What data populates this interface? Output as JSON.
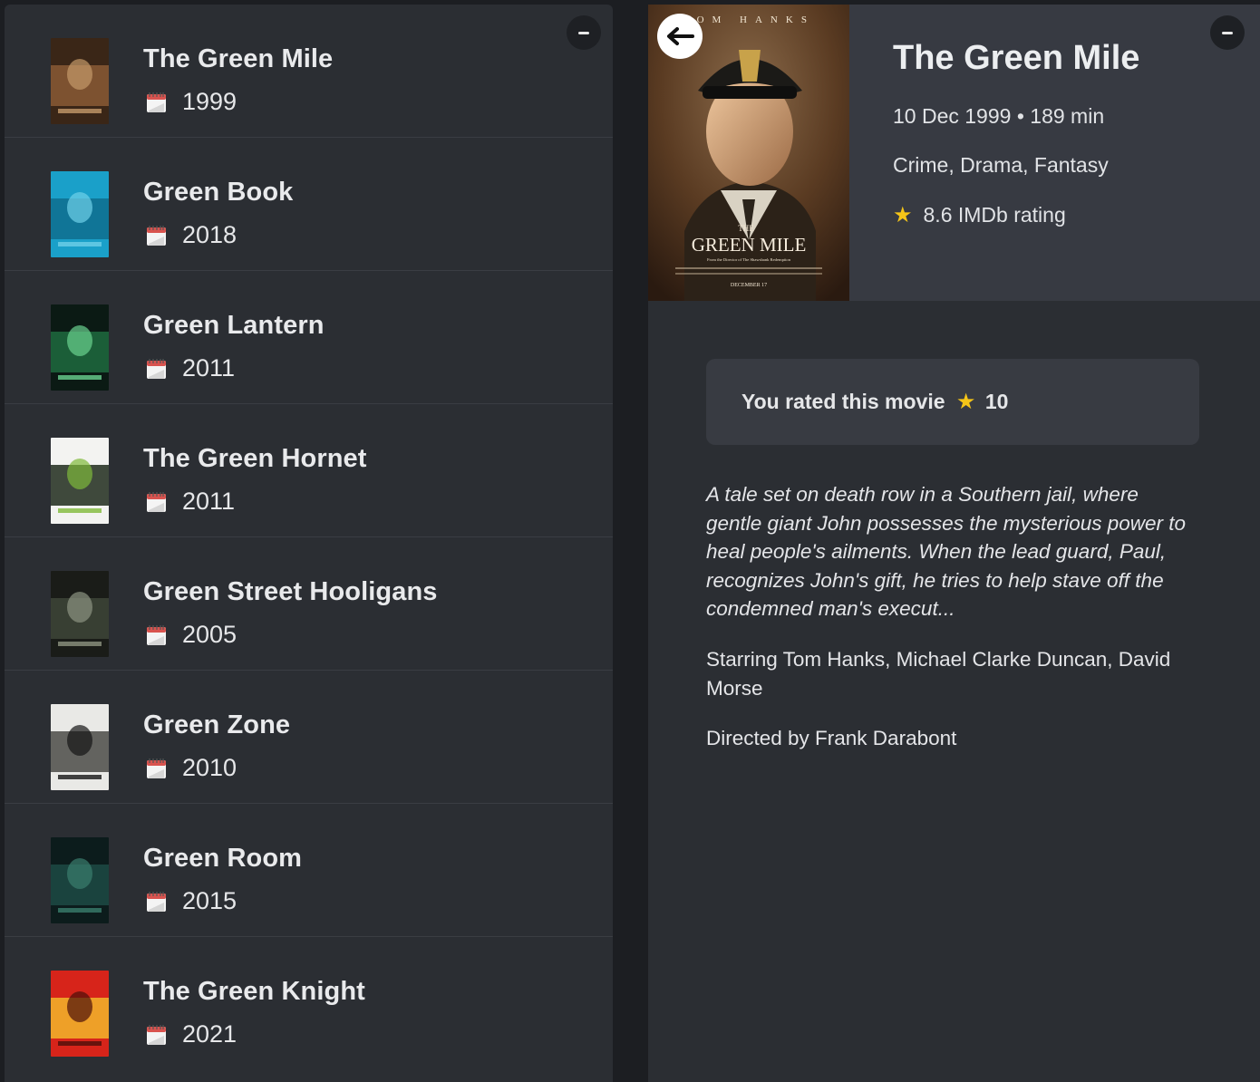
{
  "list": {
    "items": [
      {
        "title": "The Green Mile",
        "year": "1999",
        "poster_colors": [
          "#3a2617",
          "#8a5a35",
          "#c49a6a"
        ]
      },
      {
        "title": "Green Book",
        "year": "2018",
        "poster_colors": [
          "#1aa0c9",
          "#0f6d8e",
          "#6fd0e8"
        ]
      },
      {
        "title": "Green Lantern",
        "year": "2011",
        "poster_colors": [
          "#0b1a14",
          "#1f6b3e",
          "#69d18e"
        ]
      },
      {
        "title": "The Green Hornet",
        "year": "2011",
        "poster_colors": [
          "#f3f3f1",
          "#1e2a1c",
          "#7fb93a"
        ]
      },
      {
        "title": "Green Street Hooligans",
        "year": "2005",
        "poster_colors": [
          "#1a1c18",
          "#3e4538",
          "#8d9481"
        ]
      },
      {
        "title": "Green Zone",
        "year": "2010",
        "poster_colors": [
          "#e9e9e6",
          "#4b4b47",
          "#151515"
        ]
      },
      {
        "title": "Green Room",
        "year": "2015",
        "poster_colors": [
          "#0c1c1c",
          "#1d4a44",
          "#3a7e6d"
        ]
      },
      {
        "title": "The Green Knight",
        "year": "2021",
        "poster_colors": [
          "#d7241a",
          "#f2b62b",
          "#4b0f0a"
        ]
      }
    ]
  },
  "detail": {
    "title": "The Green Mile",
    "release_date": "10 Dec 1999",
    "runtime": "189 min",
    "genres": "Crime, Drama, Fantasy",
    "imdb_rating_text": "8.6 IMDb rating",
    "user_rating_text": "You rated this movie",
    "user_rating_value": "10",
    "overview": "A tale set on death row in a Southern jail, where gentle giant John possesses the mysterious power to heal people's ailments. When the lead guard, Paul, recognizes John's gift, he tries to help stave off the condemned man's execut...",
    "starring": "Starring Tom Hanks, Michael Clarke Duncan, David Morse",
    "directed": "Directed by Frank Darabont",
    "poster": {
      "top_text": "TOM HANKS",
      "title_text": "GREEN MILE",
      "the_text": "THE",
      "tagline": "From the Director of The Shawshank Redemption",
      "date_text": "DECEMBER 17"
    }
  },
  "icons": {
    "calendar": "calendar-icon",
    "star": "star-icon",
    "back": "back-arrow-icon",
    "collapse": "minus-icon"
  },
  "colors": {
    "background": "#1c1e22",
    "panel": "#2b2e33",
    "header": "#373a42",
    "rated_box": "#383b42",
    "star": "#f5c518"
  }
}
